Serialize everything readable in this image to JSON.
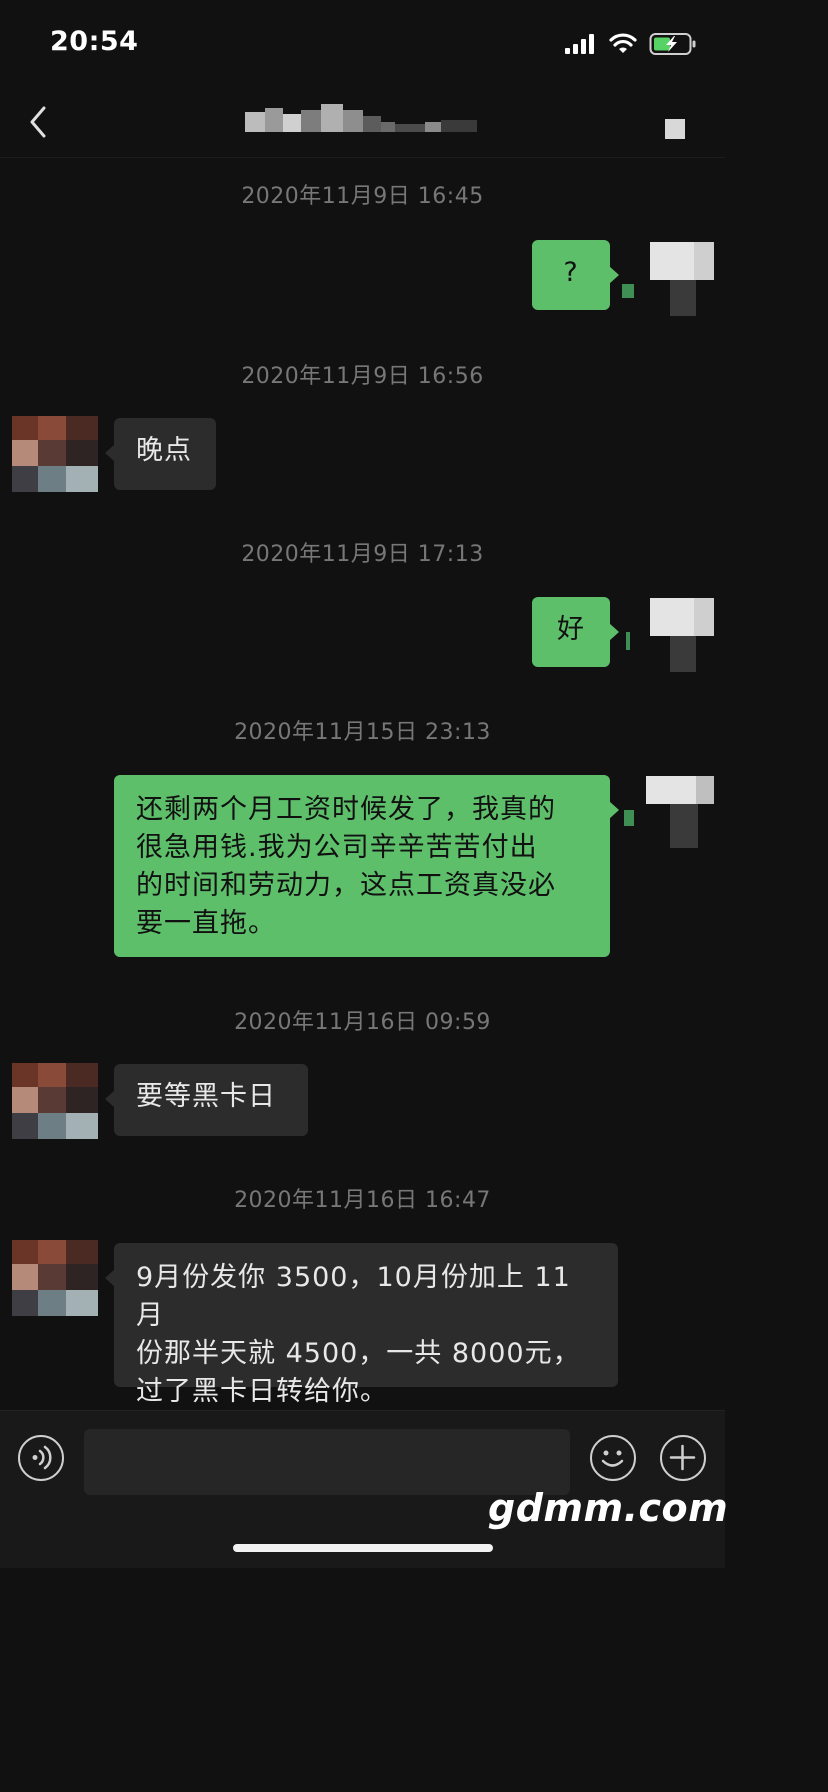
{
  "status_bar": {
    "time": "20:54"
  },
  "nav": {
    "title": ""
  },
  "messages": [
    {
      "id": "m1",
      "time": "2020年11月9日 16:45",
      "side": "right",
      "text": "?"
    },
    {
      "id": "m2",
      "time": "2020年11月9日 16:56",
      "side": "left",
      "text": "晚点"
    },
    {
      "id": "m3",
      "time": "2020年11月9日 17:13",
      "side": "right",
      "text": "好"
    },
    {
      "id": "m4",
      "time": "2020年11月15日 23:13",
      "side": "right",
      "lines": [
        "还剩两个月工资时候发了，我真的",
        "很急用钱.我为公司辛辛苦苦付出",
        "的时间和劳动力，这点工资真没必",
        "要一直拖。"
      ]
    },
    {
      "id": "m5",
      "time": "2020年11月16日 09:59",
      "side": "left",
      "text": "要等黑卡日"
    },
    {
      "id": "m6",
      "time": "2020年11月16日 16:47",
      "side": "left",
      "lines": [
        "9月份发你 3500，10月份加上 11月",
        "份那半天就 4500，一共 8000元，",
        "过了黑卡日转给你。"
      ]
    }
  ],
  "input": {
    "value": ""
  },
  "watermark": "gdmm.com",
  "colors": {
    "background": "#111111",
    "sent_bubble": "#5ebf6b",
    "received_bubble": "#2c2c2c",
    "timestamp": "#777777"
  },
  "icons": [
    "back-arrow-icon",
    "more-icon",
    "signal-icon",
    "wifi-icon",
    "battery-charging-icon",
    "voice-icon",
    "emoji-icon",
    "plus-icon"
  ]
}
